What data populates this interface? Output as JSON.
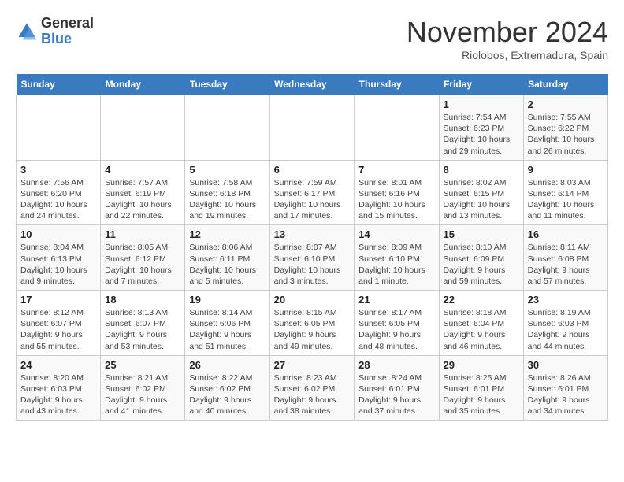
{
  "logo": {
    "general": "General",
    "blue": "Blue"
  },
  "title": "November 2024",
  "subtitle": "Riolobos, Extremadura, Spain",
  "days_of_week": [
    "Sunday",
    "Monday",
    "Tuesday",
    "Wednesday",
    "Thursday",
    "Friday",
    "Saturday"
  ],
  "weeks": [
    [
      {
        "day": "",
        "info": ""
      },
      {
        "day": "",
        "info": ""
      },
      {
        "day": "",
        "info": ""
      },
      {
        "day": "",
        "info": ""
      },
      {
        "day": "",
        "info": ""
      },
      {
        "day": "1",
        "info": "Sunrise: 7:54 AM\nSunset: 6:23 PM\nDaylight: 10 hours and 29 minutes."
      },
      {
        "day": "2",
        "info": "Sunrise: 7:55 AM\nSunset: 6:22 PM\nDaylight: 10 hours and 26 minutes."
      }
    ],
    [
      {
        "day": "3",
        "info": "Sunrise: 7:56 AM\nSunset: 6:20 PM\nDaylight: 10 hours and 24 minutes."
      },
      {
        "day": "4",
        "info": "Sunrise: 7:57 AM\nSunset: 6:19 PM\nDaylight: 10 hours and 22 minutes."
      },
      {
        "day": "5",
        "info": "Sunrise: 7:58 AM\nSunset: 6:18 PM\nDaylight: 10 hours and 19 minutes."
      },
      {
        "day": "6",
        "info": "Sunrise: 7:59 AM\nSunset: 6:17 PM\nDaylight: 10 hours and 17 minutes."
      },
      {
        "day": "7",
        "info": "Sunrise: 8:01 AM\nSunset: 6:16 PM\nDaylight: 10 hours and 15 minutes."
      },
      {
        "day": "8",
        "info": "Sunrise: 8:02 AM\nSunset: 6:15 PM\nDaylight: 10 hours and 13 minutes."
      },
      {
        "day": "9",
        "info": "Sunrise: 8:03 AM\nSunset: 6:14 PM\nDaylight: 10 hours and 11 minutes."
      }
    ],
    [
      {
        "day": "10",
        "info": "Sunrise: 8:04 AM\nSunset: 6:13 PM\nDaylight: 10 hours and 9 minutes."
      },
      {
        "day": "11",
        "info": "Sunrise: 8:05 AM\nSunset: 6:12 PM\nDaylight: 10 hours and 7 minutes."
      },
      {
        "day": "12",
        "info": "Sunrise: 8:06 AM\nSunset: 6:11 PM\nDaylight: 10 hours and 5 minutes."
      },
      {
        "day": "13",
        "info": "Sunrise: 8:07 AM\nSunset: 6:10 PM\nDaylight: 10 hours and 3 minutes."
      },
      {
        "day": "14",
        "info": "Sunrise: 8:09 AM\nSunset: 6:10 PM\nDaylight: 10 hours and 1 minute."
      },
      {
        "day": "15",
        "info": "Sunrise: 8:10 AM\nSunset: 6:09 PM\nDaylight: 9 hours and 59 minutes."
      },
      {
        "day": "16",
        "info": "Sunrise: 8:11 AM\nSunset: 6:08 PM\nDaylight: 9 hours and 57 minutes."
      }
    ],
    [
      {
        "day": "17",
        "info": "Sunrise: 8:12 AM\nSunset: 6:07 PM\nDaylight: 9 hours and 55 minutes."
      },
      {
        "day": "18",
        "info": "Sunrise: 8:13 AM\nSunset: 6:07 PM\nDaylight: 9 hours and 53 minutes."
      },
      {
        "day": "19",
        "info": "Sunrise: 8:14 AM\nSunset: 6:06 PM\nDaylight: 9 hours and 51 minutes."
      },
      {
        "day": "20",
        "info": "Sunrise: 8:15 AM\nSunset: 6:05 PM\nDaylight: 9 hours and 49 minutes."
      },
      {
        "day": "21",
        "info": "Sunrise: 8:17 AM\nSunset: 6:05 PM\nDaylight: 9 hours and 48 minutes."
      },
      {
        "day": "22",
        "info": "Sunrise: 8:18 AM\nSunset: 6:04 PM\nDaylight: 9 hours and 46 minutes."
      },
      {
        "day": "23",
        "info": "Sunrise: 8:19 AM\nSunset: 6:03 PM\nDaylight: 9 hours and 44 minutes."
      }
    ],
    [
      {
        "day": "24",
        "info": "Sunrise: 8:20 AM\nSunset: 6:03 PM\nDaylight: 9 hours and 43 minutes."
      },
      {
        "day": "25",
        "info": "Sunrise: 8:21 AM\nSunset: 6:02 PM\nDaylight: 9 hours and 41 minutes."
      },
      {
        "day": "26",
        "info": "Sunrise: 8:22 AM\nSunset: 6:02 PM\nDaylight: 9 hours and 40 minutes."
      },
      {
        "day": "27",
        "info": "Sunrise: 8:23 AM\nSunset: 6:02 PM\nDaylight: 9 hours and 38 minutes."
      },
      {
        "day": "28",
        "info": "Sunrise: 8:24 AM\nSunset: 6:01 PM\nDaylight: 9 hours and 37 minutes."
      },
      {
        "day": "29",
        "info": "Sunrise: 8:25 AM\nSunset: 6:01 PM\nDaylight: 9 hours and 35 minutes."
      },
      {
        "day": "30",
        "info": "Sunrise: 8:26 AM\nSunset: 6:01 PM\nDaylight: 9 hours and 34 minutes."
      }
    ]
  ]
}
